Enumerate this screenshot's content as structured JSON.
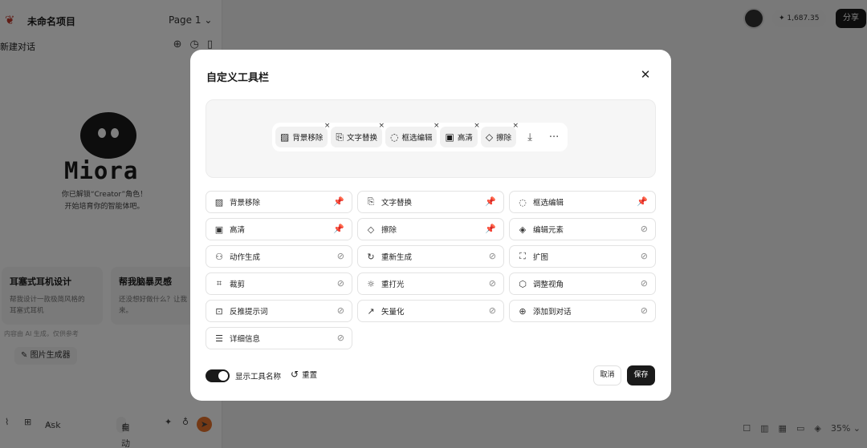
{
  "app": {
    "project_name": "未命名项目",
    "page_selector": "Page 1",
    "new_chat": "新建对话",
    "brand": "Miora",
    "unlock_line1": "你已解锁“Creator”角色！",
    "unlock_line2": "开始培育你的智能体吧。",
    "suggestions": [
      {
        "title": "耳塞式耳机设计",
        "body1": "帮我设计一款极简风格的",
        "body2": "耳塞式耳机"
      },
      {
        "title": "帮我脑暴灵感",
        "body1": "还没想好做什么？让我",
        "body2": "来。"
      }
    ],
    "disclaimer": "内容由 AI 生成，仅供参考",
    "image_generator": "图片生成器",
    "mode_label": "Ask",
    "auto_label": "自动",
    "credits": "1,687.35",
    "share_label": "分享",
    "zoom": "35%"
  },
  "modal": {
    "title": "自定义工具栏",
    "preview_toolbar": [
      {
        "icon": "image-icon",
        "label": "背景移除"
      },
      {
        "icon": "text-swap-icon",
        "label": "文字替换"
      },
      {
        "icon": "lasso-icon",
        "label": "框选编辑"
      },
      {
        "icon": "hd-icon",
        "label": "高清"
      },
      {
        "icon": "eraser-icon",
        "label": "擦除"
      }
    ],
    "tools": [
      {
        "label": "背景移除",
        "pinned": true
      },
      {
        "label": "文字替换",
        "pinned": true
      },
      {
        "label": "框选编辑",
        "pinned": true
      },
      {
        "label": "高清",
        "pinned": true
      },
      {
        "label": "擦除",
        "pinned": true
      },
      {
        "label": "编辑元素",
        "pinned": false
      },
      {
        "label": "动作生成",
        "pinned": false
      },
      {
        "label": "重新生成",
        "pinned": false
      },
      {
        "label": "扩图",
        "pinned": false
      },
      {
        "label": "裁剪",
        "pinned": false
      },
      {
        "label": "重打光",
        "pinned": false
      },
      {
        "label": "调整视角",
        "pinned": false
      },
      {
        "label": "反推提示词",
        "pinned": false
      },
      {
        "label": "矢量化",
        "pinned": false
      },
      {
        "label": "添加到对话",
        "pinned": false
      },
      {
        "label": "详细信息",
        "pinned": false
      }
    ],
    "show_names_label": "显示工具名称",
    "show_names_on": true,
    "reset_label": "重置",
    "cancel_label": "取消",
    "save_label": "保存"
  }
}
